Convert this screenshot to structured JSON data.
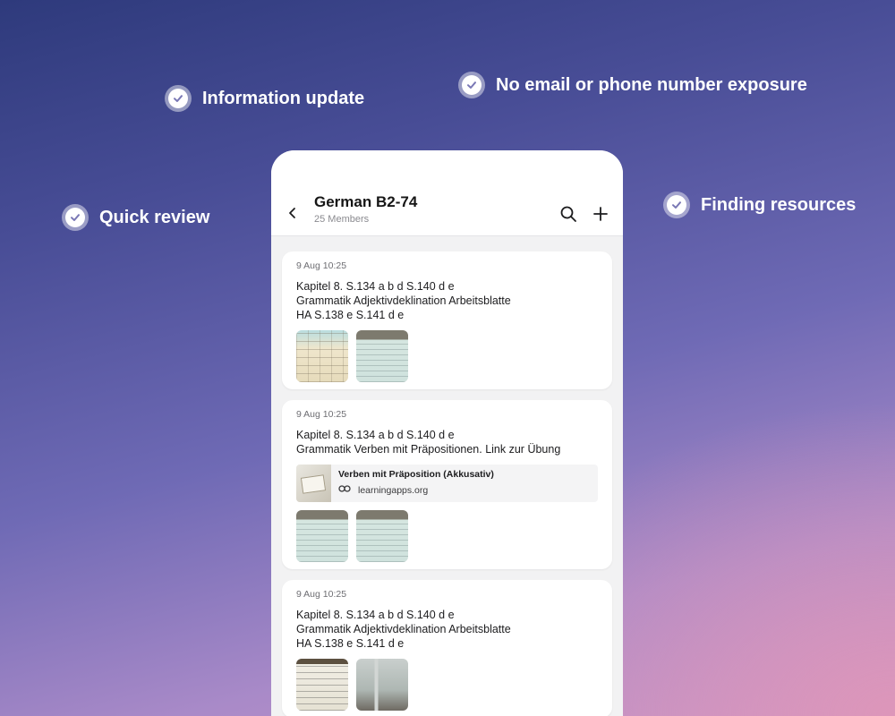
{
  "features": {
    "information_update": "Information update",
    "no_exposure": "No email or phone number exposure",
    "quick_review": "Quick review",
    "finding_resources": "Finding resources"
  },
  "header": {
    "title": "German B2-74",
    "members": "25 Members",
    "back_icon": "chevron-left-icon",
    "search_icon": "search-icon",
    "add_icon": "plus-icon"
  },
  "posts": [
    {
      "time": "9 Aug 10:25",
      "lines": [
        "Kapitel 8. S.134 a b d S.140 d e",
        "Grammatik Adjektivdeklination Arbeitsblatte",
        "HA S.138 e S.141 d e"
      ]
    },
    {
      "time": "9 Aug 10:25",
      "lines": [
        "Kapitel 8. S.134 a b d S.140 d e",
        "Grammatik Verben mit Präpositionen. Link zur Übung"
      ],
      "link": {
        "title": "Verben mit Präposition (Akkusativ)",
        "url": "learningapps.org"
      }
    },
    {
      "time": "9 Aug 10:25",
      "lines": [
        "Kapitel 8. S.134 a b d S.140 d e",
        "Grammatik Adjektivdeklination Arbeitsblatte",
        "HA S.138 e S.141 d e"
      ]
    }
  ],
  "colors": {
    "accent_white": "#ffffff",
    "text_dark": "#1c1c1e",
    "muted": "#8a8a8f"
  }
}
